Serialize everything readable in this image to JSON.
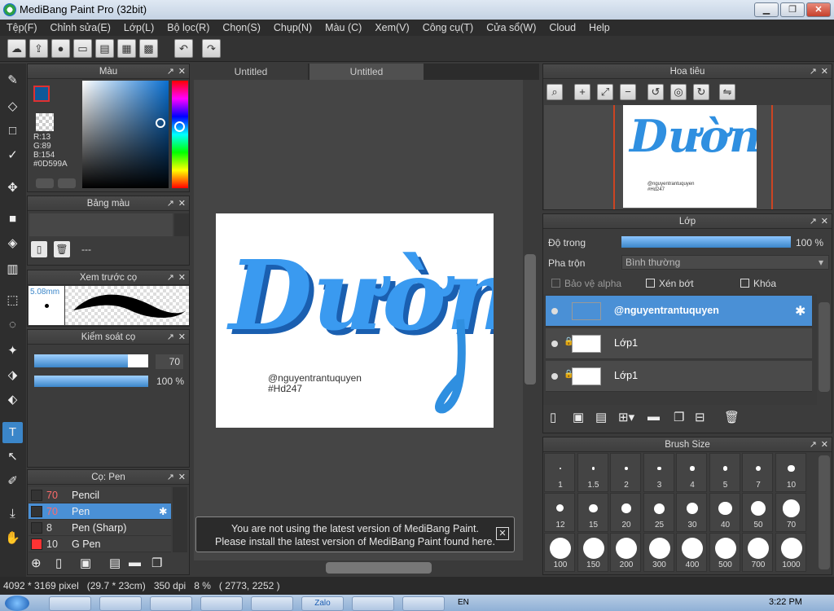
{
  "window": {
    "title": "MediBang Paint Pro (32bit)",
    "min": "▁",
    "max": "❐",
    "close": "✕"
  },
  "menu": [
    "Tệp(F)",
    "Chỉnh sửa(E)",
    "Lớp(L)",
    "Bộ lọc(R)",
    "Chọn(S)",
    "Chụp(N)",
    "Màu (C)",
    "Xem(V)",
    "Công cụ(T)",
    "Cửa sổ(W)",
    "Cloud",
    "Help"
  ],
  "tabs": [
    "Untitled",
    "Untitled"
  ],
  "color_panel": {
    "title": "Màu",
    "r": "R:13",
    "g": "G:89",
    "b": "B:154",
    "hex": "#0D599A",
    "fg": "#0d599a"
  },
  "palette_panel": {
    "title": "Bảng màu",
    "value": "---"
  },
  "preview_panel": {
    "title": "Xem trước cọ",
    "size": "5.08mm"
  },
  "brush_control": {
    "title": "Kiểm soát cọ",
    "size_value": "70",
    "opacity_value": "100 %",
    "size_fraction": 0.82,
    "opacity_fraction": 1.0
  },
  "brush_list": {
    "title": "Cọ: Pen",
    "items": [
      {
        "size": "70",
        "name": "Pencil",
        "swatch": "#333333",
        "size_color": "#ff6b6b"
      },
      {
        "size": "70",
        "name": "Pen",
        "swatch": "#333333",
        "size_color": "#ff6b6b"
      },
      {
        "size": "8",
        "name": "Pen (Sharp)",
        "swatch": "#333333",
        "size_color": "#dddddd"
      },
      {
        "size": "10",
        "name": "G Pen",
        "swatch": "#ff3333",
        "size_color": "#dddddd"
      }
    ]
  },
  "canvas": {
    "art_text": "Dường",
    "credit_line1": "@nguyentrantuquyen",
    "credit_line2": "#Hd247",
    "art_color": "#2f8fe0",
    "art_shadow": "#1a5fb0"
  },
  "notice": {
    "line1": "You are not using the latest version of MediBang Paint.",
    "line2": "Please install the latest version of MediBang Paint found here.",
    "close": "✕"
  },
  "navigator": {
    "title": "Hoa tiêu"
  },
  "layers_panel": {
    "title": "Lớp",
    "opacity_label": "Độ trong",
    "opacity_value": "100 %",
    "opacity_fraction": 1.0,
    "blend_label": "Pha trộn",
    "blend_value": "Bình thường",
    "protect_alpha": "Bảo vệ alpha",
    "clipping": "Xén bớt",
    "lock": "Khóa",
    "layers": [
      {
        "name": "@nguyentrantuquyen"
      },
      {
        "name": "Lớp1"
      },
      {
        "name": "Lớp1"
      }
    ]
  },
  "brush_size_panel": {
    "title": "Brush Size",
    "sizes": [
      "1",
      "1.5",
      "2",
      "3",
      "4",
      "5",
      "7",
      "10",
      "12",
      "15",
      "20",
      "25",
      "30",
      "40",
      "50",
      "70",
      "100",
      "150",
      "200",
      "300",
      "400",
      "500",
      "700",
      "1000"
    ]
  },
  "status": {
    "dims": "4092 * 3169 pixel",
    "cm": "(29.7 * 23cm)",
    "dpi": "350 dpi",
    "zoom": "8 %",
    "coords": "( 2773, 2252 )"
  },
  "taskbar": {
    "lang": "EN",
    "time": "3:22 PM",
    "zalo": "Zalo"
  }
}
